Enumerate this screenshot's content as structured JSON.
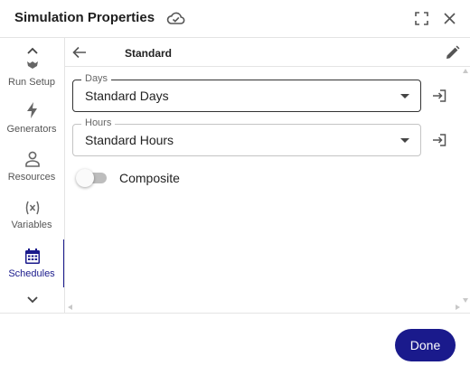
{
  "dialog": {
    "title": "Simulation Properties",
    "icons": {
      "sync": "cloud-check-icon",
      "expand": "expand-icon",
      "close": "close-icon"
    }
  },
  "sidebar": {
    "items": [
      {
        "label": "Run Setup",
        "icon": "gear-icon",
        "active": false
      },
      {
        "label": "Generators",
        "icon": "lightning-icon",
        "active": false
      },
      {
        "label": "Resources",
        "icon": "person-icon",
        "active": false
      },
      {
        "label": "Variables",
        "icon": "variable-icon",
        "active": false
      },
      {
        "label": "Schedules",
        "icon": "calendar-icon",
        "active": true
      }
    ]
  },
  "main": {
    "subtitle": "Standard",
    "fields": [
      {
        "legend": "Days",
        "value": "Standard Days"
      },
      {
        "legend": "Hours",
        "value": "Standard Hours"
      }
    ],
    "toggle": {
      "label": "Composite",
      "on": false
    }
  },
  "footer": {
    "done_label": "Done"
  },
  "colors": {
    "accent": "#1a1a8c",
    "border": "#e4e4e4",
    "text": "#222222"
  }
}
